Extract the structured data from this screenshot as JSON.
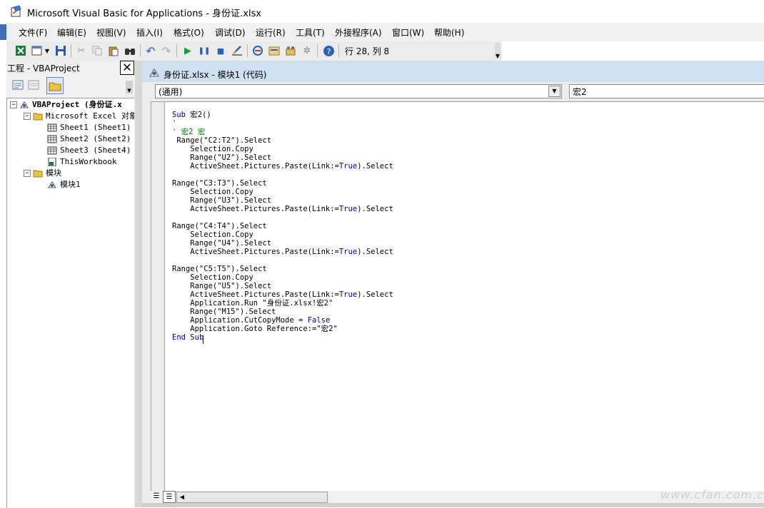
{
  "window": {
    "title": "Microsoft Visual Basic for Applications - 身份证.xlsx"
  },
  "menu": [
    "文件(F)",
    "编辑(E)",
    "视图(V)",
    "插入(I)",
    "格式(O)",
    "调试(D)",
    "运行(R)",
    "工具(T)",
    "外接程序(A)",
    "窗口(W)",
    "帮助(H)"
  ],
  "toolbar": {
    "position": "行 28, 列 8"
  },
  "project": {
    "title": "工程 - VBAProject",
    "root": "VBAProject (身份证.x",
    "excel_objects": "Microsoft Excel 对象",
    "sheets": [
      "Sheet1 (Sheet1)",
      "Sheet2 (Sheet2)",
      "Sheet3 (Sheet4)"
    ],
    "workbook": "ThisWorkbook",
    "modules_folder": "模块",
    "module": "模块1"
  },
  "code_window": {
    "title": "身份证.xlsx - 模块1 (代码)",
    "object_combo": "(通用)",
    "proc_combo": "宏2",
    "lines": [
      "Sub 宏2()",
      "'",
      "' 宏2 宏",
      " Range(\"C2:T2\").Select",
      "    Selection.Copy",
      "    Range(\"U2\").Select",
      "    ActiveSheet.Pictures.Paste(Link:=True).Select",
      "",
      "Range(\"C3:T3\").Select",
      "    Selection.Copy",
      "    Range(\"U3\").Select",
      "    ActiveSheet.Pictures.Paste(Link:=True).Select",
      "",
      "Range(\"C4:T4\").Select",
      "    Selection.Copy",
      "    Range(\"U4\").Select",
      "    ActiveSheet.Pictures.Paste(Link:=True).Select",
      "",
      "Range(\"C5:T5\").Select",
      "    Selection.Copy",
      "    Range(\"U5\").Select",
      "    ActiveSheet.Pictures.Paste(Link:=True).Select",
      "    Application.Run \"身份证.xlsx!宏2\"",
      "    Range(\"M15\").Select",
      "    Application.CutCopyMode = False",
      "    Application.Goto Reference:=\"宏2\"",
      "End Sub"
    ]
  },
  "watermark": "www.cfan.com.cn"
}
